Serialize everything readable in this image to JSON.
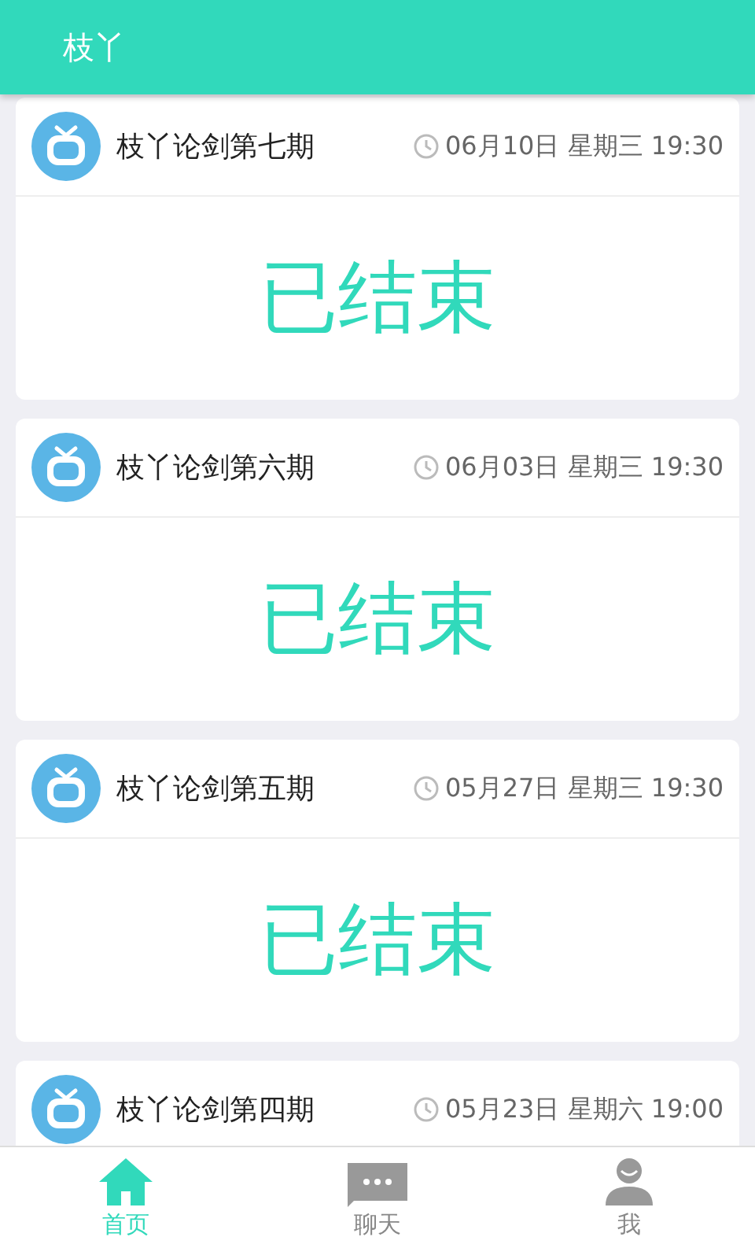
{
  "app_bar": {
    "title": "枝丫"
  },
  "sessions": [
    {
      "title": "枝丫论剑第七期",
      "time": "06月10日 星期三 19:30",
      "status": "已结束"
    },
    {
      "title": "枝丫论剑第六期",
      "time": "06月03日 星期三 19:30",
      "status": "已结束"
    },
    {
      "title": "枝丫论剑第五期",
      "time": "05月27日 星期三 19:30",
      "status": "已结束"
    },
    {
      "title": "枝丫论剑第四期",
      "time": "05月23日 星期六 19:00"
    }
  ],
  "tabs": [
    {
      "kind": "home",
      "label": "首页",
      "selected": true
    },
    {
      "kind": "chat",
      "label": "聊天",
      "selected": false
    },
    {
      "kind": "me",
      "label": "我",
      "selected": false
    }
  ]
}
